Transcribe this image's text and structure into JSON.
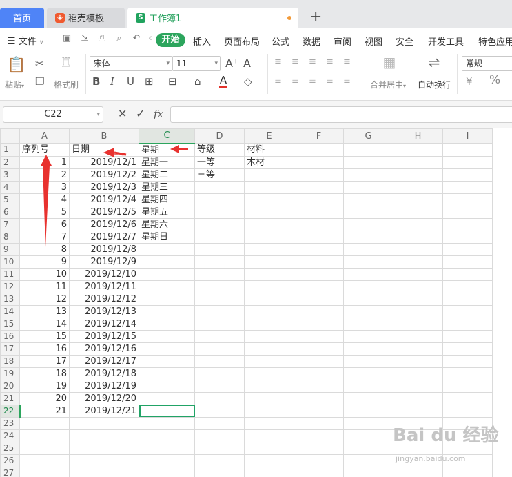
{
  "tabs": [
    {
      "label": "首页"
    },
    {
      "label": "稻壳模板",
      "icon": "daoke-icon"
    },
    {
      "label": "工作簿1",
      "icon": "spreadsheet-icon"
    }
  ],
  "menu": {
    "file": "文件",
    "items": [
      "开始",
      "插入",
      "页面布局",
      "公式",
      "数据",
      "审阅",
      "视图",
      "安全",
      "开发工具",
      "特色应用"
    ]
  },
  "ribbon": {
    "paste": "粘贴",
    "format_painter": "格式刷",
    "font": "宋体",
    "size": "11",
    "merge": "合并居中",
    "wrap": "自动换行",
    "number_format": "常规",
    "percent": "%"
  },
  "formula_bar": {
    "name_box": "C22",
    "fx": "fx",
    "value": ""
  },
  "grid": {
    "columns": [
      "A",
      "B",
      "C",
      "D",
      "E",
      "F",
      "G",
      "H",
      "I"
    ],
    "active_column": "C",
    "active_row": 22,
    "rows": [
      [
        "序列号",
        "日期",
        "星期",
        "等级",
        "材料"
      ],
      [
        "1",
        "2019/12/1",
        "星期一",
        "一等",
        "木材"
      ],
      [
        "2",
        "2019/12/2",
        "星期二",
        "三等",
        ""
      ],
      [
        "3",
        "2019/12/3",
        "星期三",
        "",
        ""
      ],
      [
        "4",
        "2019/12/4",
        "星期四",
        "",
        ""
      ],
      [
        "5",
        "2019/12/5",
        "星期五",
        "",
        ""
      ],
      [
        "6",
        "2019/12/6",
        "星期六",
        "",
        ""
      ],
      [
        "7",
        "2019/12/7",
        "星期日",
        "",
        ""
      ],
      [
        "8",
        "2019/12/8",
        "",
        "",
        ""
      ],
      [
        "9",
        "2019/12/9",
        "",
        "",
        ""
      ],
      [
        "10",
        "2019/12/10",
        "",
        "",
        ""
      ],
      [
        "11",
        "2019/12/11",
        "",
        "",
        ""
      ],
      [
        "12",
        "2019/12/12",
        "",
        "",
        ""
      ],
      [
        "13",
        "2019/12/13",
        "",
        "",
        ""
      ],
      [
        "14",
        "2019/12/14",
        "",
        "",
        ""
      ],
      [
        "15",
        "2019/12/15",
        "",
        "",
        ""
      ],
      [
        "16",
        "2019/12/16",
        "",
        "",
        ""
      ],
      [
        "17",
        "2019/12/17",
        "",
        "",
        ""
      ],
      [
        "18",
        "2019/12/18",
        "",
        "",
        ""
      ],
      [
        "19",
        "2019/12/19",
        "",
        "",
        ""
      ],
      [
        "20",
        "2019/12/20",
        "",
        "",
        ""
      ],
      [
        "21",
        "2019/12/21",
        "",
        "",
        ""
      ],
      [
        "",
        "",
        "",
        "",
        ""
      ],
      [
        "",
        "",
        "",
        "",
        ""
      ],
      [
        "",
        "",
        "",
        "",
        ""
      ],
      [
        "",
        "",
        "",
        "",
        ""
      ],
      [
        "",
        "",
        "",
        "",
        ""
      ]
    ]
  },
  "watermark": {
    "logo": "Bai du 经验",
    "url": "jingyan.baidu.com"
  },
  "colors": {
    "accent": "#2ca55d",
    "tab_home": "#4f84f7",
    "arrow": "#e8322f"
  }
}
